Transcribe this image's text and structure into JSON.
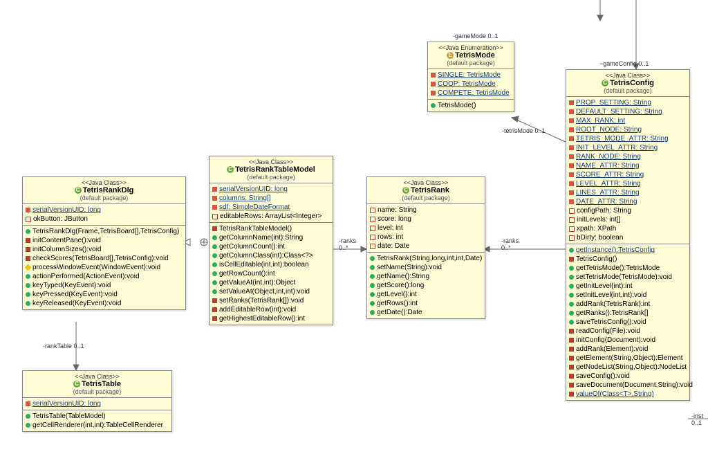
{
  "stereotypes": {
    "class": "<<Java Class>>",
    "enum": "<<Java Enumeration>>"
  },
  "pkg": "(default package)",
  "classes": {
    "TetrisMode": {
      "name": "TetrisMode",
      "literals": [
        "SINGLE: TetrisMode",
        "COOP: TetrisMode",
        "COMPETE: TetrisMode"
      ],
      "ops": [
        "TetrisMode()"
      ]
    },
    "TetrisRankDlg": {
      "name": "TetrisRankDlg",
      "attrs": [
        {
          "i": "sf",
          "t": "serialVersionUID: long",
          "s": true
        },
        {
          "i": "attr-sq",
          "t": "okButton: JButton"
        }
      ],
      "ops": [
        {
          "i": "green-circ",
          "t": "TetrisRankDlg(Frame,TetrisBoard[],TetrisConfig)"
        },
        {
          "i": "red-sq",
          "t": "initContentPane():void"
        },
        {
          "i": "red-sq",
          "t": "initColumnSizes():void"
        },
        {
          "i": "red-sq",
          "t": "checkScores(TetrisBoard[],TetrisConfig):void"
        },
        {
          "i": "yellow-diam",
          "t": "processWindowEvent(WindowEvent):void"
        },
        {
          "i": "green-circ",
          "t": "actionPerformed(ActionEvent):void"
        },
        {
          "i": "green-circ",
          "t": "keyTyped(KeyEvent):void"
        },
        {
          "i": "green-circ",
          "t": "keyPressed(KeyEvent):void"
        },
        {
          "i": "green-circ",
          "t": "keyReleased(KeyEvent):void"
        }
      ]
    },
    "TetrisTable": {
      "name": "TetrisTable",
      "attrs": [
        {
          "i": "sf",
          "t": "serialVersionUID: long",
          "s": true
        }
      ],
      "ops": [
        {
          "i": "green-circ",
          "t": "TetrisTable(TableModel)"
        },
        {
          "i": "green-circ",
          "t": "getCellRenderer(int,int):TableCellRenderer"
        }
      ]
    },
    "TetrisRankTableModel": {
      "name": "TetrisRankTableModel",
      "attrs": [
        {
          "i": "sf",
          "t": "serialVersionUID: long",
          "s": true
        },
        {
          "i": "sf",
          "t": "columns: String[]",
          "s": true
        },
        {
          "i": "sf",
          "t": "sdf: SimpleDateFormat",
          "s": true
        },
        {
          "i": "attr-sq",
          "t": "editableRows: ArrayList<Integer>"
        }
      ],
      "ops": [
        {
          "i": "red-sq",
          "t": "TetrisRankTableModel()"
        },
        {
          "i": "green-circ",
          "t": "getColumnName(int):String"
        },
        {
          "i": "green-circ",
          "t": "getColumnCount():int"
        },
        {
          "i": "green-circ",
          "t": "getColumnClass(int):Class<?>"
        },
        {
          "i": "green-circ",
          "t": "isCellEditable(int,int):boolean"
        },
        {
          "i": "green-circ",
          "t": "getRowCount():int"
        },
        {
          "i": "green-circ",
          "t": "getValueAt(int,int):Object"
        },
        {
          "i": "green-circ",
          "t": "setValueAt(Object,int,int):void"
        },
        {
          "i": "red-sq",
          "t": "setRanks(TetrisRank[]):void"
        },
        {
          "i": "red-sq",
          "t": "addEditableRow(int):void"
        },
        {
          "i": "red-sq",
          "t": "getHighestEditableRow():int"
        }
      ]
    },
    "TetrisRank": {
      "name": "TetrisRank",
      "attrs": [
        {
          "i": "attr-sq",
          "t": "name: String"
        },
        {
          "i": "attr-sq",
          "t": "score: long"
        },
        {
          "i": "attr-sq",
          "t": "level: int"
        },
        {
          "i": "attr-sq",
          "t": "rows: int"
        },
        {
          "i": "attr-sq",
          "t": "date: Date"
        }
      ],
      "ops": [
        {
          "i": "green-circ",
          "t": "TetrisRank(String,long,int,int,Date)"
        },
        {
          "i": "green-circ",
          "t": "setName(String):void"
        },
        {
          "i": "green-circ",
          "t": "getName():String"
        },
        {
          "i": "green-circ",
          "t": "getScore():long"
        },
        {
          "i": "green-circ",
          "t": "getLevel():int"
        },
        {
          "i": "green-circ",
          "t": "getRows():int"
        },
        {
          "i": "green-circ",
          "t": "getDate():Date"
        }
      ]
    },
    "TetrisConfig": {
      "name": "TetrisConfig",
      "attrs": [
        {
          "i": "sf",
          "t": "PROP_SETTING: String",
          "s": true
        },
        {
          "i": "sf",
          "t": "DEFAULT_SETTING: String",
          "s": true
        },
        {
          "i": "sf",
          "t": "MAX_RANK: int",
          "s": true
        },
        {
          "i": "sf",
          "t": "ROOT_NODE: String",
          "s": true
        },
        {
          "i": "sf",
          "t": "TETRIS_MODE_ATTR: String",
          "s": true
        },
        {
          "i": "sf",
          "t": "INIT_LEVEL_ATTR: String",
          "s": true
        },
        {
          "i": "sf",
          "t": "RANK_NODE: String",
          "s": true
        },
        {
          "i": "sf",
          "t": "NAME_ATTR: String",
          "s": true
        },
        {
          "i": "sf",
          "t": "SCORE_ATTR: String",
          "s": true
        },
        {
          "i": "sf",
          "t": "LEVEL_ATTR: String",
          "s": true
        },
        {
          "i": "sf",
          "t": "LINES_ATTR: String",
          "s": true
        },
        {
          "i": "sf",
          "t": "DATE_ATTR: String",
          "s": true
        },
        {
          "i": "attr-sq",
          "t": "configPath: String"
        },
        {
          "i": "attr-sq",
          "t": "initLevels: int[]"
        },
        {
          "i": "attr-sq",
          "t": "xpath: XPath"
        },
        {
          "i": "attr-sq",
          "t": "bDirty: boolean"
        }
      ],
      "ops": [
        {
          "i": "green-circ",
          "t": "getInstance():TetrisConfig",
          "s": true
        },
        {
          "i": "red-sq",
          "t": "TetrisConfig()"
        },
        {
          "i": "green-circ",
          "t": "getTetrisMode():TetrisMode"
        },
        {
          "i": "green-circ",
          "t": "setTetrisMode(TetrisMode):void"
        },
        {
          "i": "green-circ",
          "t": "getInitLevel(int):int"
        },
        {
          "i": "green-circ",
          "t": "setInitLevel(int,int):void"
        },
        {
          "i": "green-circ",
          "t": "addRank(TetrisRank):int"
        },
        {
          "i": "green-circ",
          "t": "getRanks():TetrisRank[]"
        },
        {
          "i": "green-circ",
          "t": "saveTetrisConfig():void"
        },
        {
          "i": "red-sq",
          "t": "readConfig(File):void"
        },
        {
          "i": "red-sq",
          "t": "initConfig(Document):void"
        },
        {
          "i": "red-sq",
          "t": "addRank(Element):void"
        },
        {
          "i": "red-sq",
          "t": "getElement(String,Object):Element"
        },
        {
          "i": "red-sq",
          "t": "getNodeList(String,Object):NodeList"
        },
        {
          "i": "red-sq",
          "t": "saveConfig():void"
        },
        {
          "i": "red-sq",
          "t": "saveDocument(Document,String):void"
        },
        {
          "i": "red-sq",
          "t": "valueOf(Class<T>,String)",
          "s": true
        }
      ]
    }
  },
  "assocs": {
    "gameMode": {
      "label": "-gameMode",
      "mult": "0..1"
    },
    "gameConfig": {
      "label": "~gameConfig",
      "mult": "0..1"
    },
    "tetrisMode": {
      "label": "-tetrisMode",
      "mult": "0..1"
    },
    "ranks1": {
      "label": "-ranks",
      "mult": "0..*"
    },
    "ranks2": {
      "label": "-ranks",
      "mult": "0..*"
    },
    "rankTable": {
      "label": "-rankTable",
      "mult": "0..1"
    },
    "inst": {
      "label": "-inst",
      "mult": "0..1"
    }
  }
}
